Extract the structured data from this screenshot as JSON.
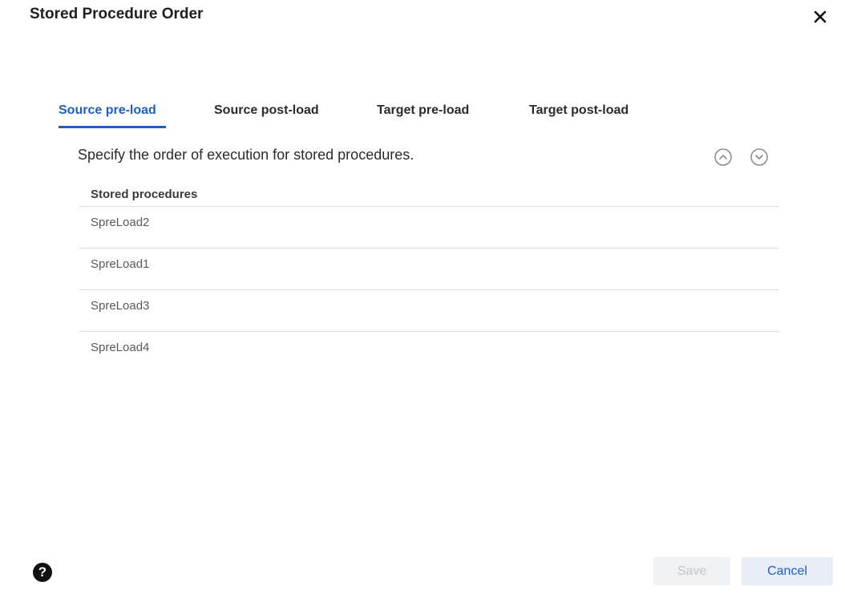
{
  "dialog": {
    "title": "Stored Procedure Order",
    "close_glyph": "✕"
  },
  "tabs": [
    {
      "label": "Source pre-load",
      "active": true
    },
    {
      "label": "Source post-load",
      "active": false
    },
    {
      "label": "Target pre-load",
      "active": false
    },
    {
      "label": "Target post-load",
      "active": false
    }
  ],
  "instruction": "Specify the order of execution for stored procedures.",
  "order_controls": {
    "move_up_icon": "chevron-up-circle-icon",
    "move_down_icon": "chevron-down-circle-icon"
  },
  "table": {
    "header": "Stored procedures",
    "rows": [
      "SpreLoad2",
      "SpreLoad1",
      "SpreLoad3",
      "SpreLoad4"
    ]
  },
  "footer": {
    "help_glyph": "?",
    "save_label": "Save",
    "save_enabled": false,
    "cancel_label": "Cancel"
  },
  "colors": {
    "accent": "#1f5fbf",
    "divider": "#dcdcdc",
    "disabled_text": "#c2c4c8"
  }
}
